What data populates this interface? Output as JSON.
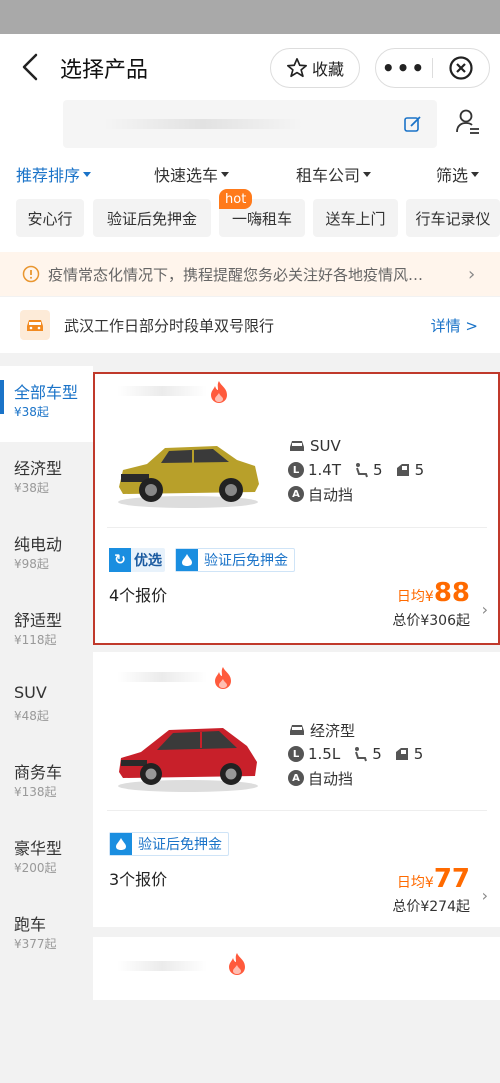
{
  "header": {
    "title": "选择产品",
    "collect_label": "收藏"
  },
  "sort_tabs": [
    {
      "label": "推荐排序",
      "active": true
    },
    {
      "label": "快速选车",
      "active": false
    },
    {
      "label": "租车公司",
      "active": false
    },
    {
      "label": "筛选",
      "active": false
    }
  ],
  "chips": [
    "安心行",
    "验证后免押金",
    "一嗨租车",
    "送车上门",
    "行车记录仪"
  ],
  "hot_badge": "hot",
  "notice": {
    "text": "疫情常态化情况下，携程提醒您务必关注好各地疫情风…"
  },
  "limit": {
    "text": "武汉工作日部分时段单双号限行",
    "link": "详情 >"
  },
  "sidebar": [
    {
      "name": "全部车型",
      "price": "¥38起",
      "active": true
    },
    {
      "name": "经济型",
      "price": "¥38起",
      "active": false
    },
    {
      "name": "纯电动",
      "price": "¥98起",
      "active": false
    },
    {
      "name": "舒适型",
      "price": "¥118起",
      "active": false
    },
    {
      "name": "SUV",
      "price": "¥48起",
      "active": false
    },
    {
      "name": "商务车",
      "price": "¥138起",
      "active": false
    },
    {
      "name": "豪华型",
      "price": "¥200起",
      "active": false
    },
    {
      "name": "跑车",
      "price": "¥377起",
      "active": false
    }
  ],
  "cards": [
    {
      "type": "SUV",
      "engine": "1.4T",
      "seats": "5",
      "doors": "5",
      "transmission": "自动挡",
      "tag_premium": "优选",
      "tag_deposit": "验证后免押金",
      "quotes": "4个报价",
      "daily_label": "日均¥",
      "daily_price": "88",
      "total": "总价¥306起",
      "car_color": "#b8a02a"
    },
    {
      "type": "经济型",
      "engine": "1.5L",
      "seats": "5",
      "doors": "5",
      "transmission": "自动挡",
      "tag_deposit": "验证后免押金",
      "quotes": "3个报价",
      "daily_label": "日均¥",
      "daily_price": "77",
      "total": "总价¥274起",
      "car_color": "#c8202a"
    }
  ],
  "colors": {
    "accent": "#1a73c8",
    "price": "#ff6a00",
    "hot": "#ff7a1a",
    "highlight_border": "#c0392b"
  }
}
